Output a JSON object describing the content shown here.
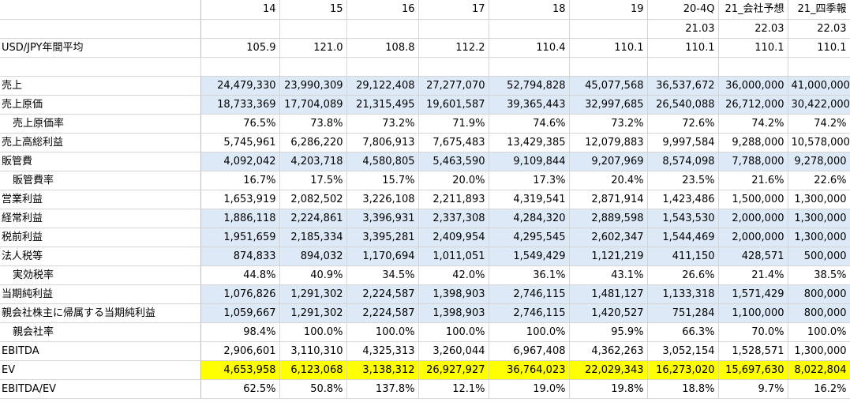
{
  "headers": {
    "years": [
      "14",
      "15",
      "16",
      "17",
      "18",
      "19",
      "20-4Q",
      "21_会社予想",
      "21_四季報"
    ],
    "periods": [
      "",
      "",
      "",
      "",
      "",
      "",
      "21.03",
      "22.03",
      "22.03"
    ]
  },
  "fx": {
    "label": "USD/JPY年間平均",
    "values": [
      "105.9",
      "121.0",
      "108.8",
      "112.2",
      "110.4",
      "110.1",
      "110.1",
      "110.1",
      "110.1"
    ]
  },
  "rows": [
    {
      "label": "売上",
      "style": "blue",
      "indent": false,
      "values": [
        "24,479,330",
        "23,990,309",
        "29,122,408",
        "27,277,070",
        "52,794,828",
        "45,077,568",
        "36,537,672",
        "36,000,000",
        "41,000,000"
      ]
    },
    {
      "label": "売上原価",
      "style": "blue",
      "indent": false,
      "values": [
        "18,733,369",
        "17,704,089",
        "21,315,495",
        "19,601,587",
        "39,365,443",
        "32,997,685",
        "26,540,088",
        "26,712,000",
        "30,422,000"
      ]
    },
    {
      "label": "売上原価率",
      "style": "plain",
      "indent": true,
      "values": [
        "76.5%",
        "73.8%",
        "73.2%",
        "71.9%",
        "74.6%",
        "73.2%",
        "72.6%",
        "74.2%",
        "74.2%"
      ]
    },
    {
      "label": "売上高総利益",
      "style": "plain",
      "indent": false,
      "values": [
        "5,745,961",
        "6,286,220",
        "7,806,913",
        "7,675,483",
        "13,429,385",
        "12,079,883",
        "9,997,584",
        "9,288,000",
        "10,578,000"
      ]
    },
    {
      "label": "販管費",
      "style": "blue",
      "indent": false,
      "values": [
        "4,092,042",
        "4,203,718",
        "4,580,805",
        "5,463,590",
        "9,109,844",
        "9,207,969",
        "8,574,098",
        "7,788,000",
        "9,278,000"
      ]
    },
    {
      "label": "販管費率",
      "style": "plain",
      "indent": true,
      "values": [
        "16.7%",
        "17.5%",
        "15.7%",
        "20.0%",
        "17.3%",
        "20.4%",
        "23.5%",
        "21.6%",
        "22.6%"
      ]
    },
    {
      "label": "営業利益",
      "style": "plain",
      "indent": false,
      "values": [
        "1,653,919",
        "2,082,502",
        "3,226,108",
        "2,211,893",
        "4,319,541",
        "2,871,914",
        "1,423,486",
        "1,500,000",
        "1,300,000"
      ]
    },
    {
      "label": "経常利益",
      "style": "blue",
      "indent": false,
      "values": [
        "1,886,118",
        "2,224,861",
        "3,396,931",
        "2,337,308",
        "4,284,320",
        "2,889,598",
        "1,543,530",
        "2,000,000",
        "1,300,000"
      ]
    },
    {
      "label": "税前利益",
      "style": "blue",
      "indent": false,
      "values": [
        "1,951,659",
        "2,185,334",
        "3,395,281",
        "2,409,954",
        "4,295,545",
        "2,602,347",
        "1,544,469",
        "2,000,000",
        "1,300,000"
      ]
    },
    {
      "label": "法人税等",
      "style": "blue",
      "indent": false,
      "values": [
        "874,833",
        "894,032",
        "1,170,694",
        "1,011,051",
        "1,549,429",
        "1,121,219",
        "411,150",
        "428,571",
        "500,000"
      ]
    },
    {
      "label": "実効税率",
      "style": "plain",
      "indent": true,
      "values": [
        "44.8%",
        "40.9%",
        "34.5%",
        "42.0%",
        "36.1%",
        "43.1%",
        "26.6%",
        "21.4%",
        "38.5%"
      ]
    },
    {
      "label": "当期純利益",
      "style": "blue",
      "indent": false,
      "values": [
        "1,076,826",
        "1,291,302",
        "2,224,587",
        "1,398,903",
        "2,746,115",
        "1,481,127",
        "1,133,318",
        "1,571,429",
        "800,000"
      ]
    },
    {
      "label": "親会社株主に帰属する当期純利益",
      "style": "blue",
      "indent": false,
      "values": [
        "1,059,667",
        "1,291,302",
        "2,224,587",
        "1,398,903",
        "2,746,115",
        "1,420,527",
        "751,284",
        "1,100,000",
        "800,000"
      ]
    },
    {
      "label": "親会社率",
      "style": "plain",
      "indent": true,
      "values": [
        "98.4%",
        "100.0%",
        "100.0%",
        "100.0%",
        "100.0%",
        "95.9%",
        "66.3%",
        "70.0%",
        "100.0%"
      ]
    },
    {
      "label": "EBITDA",
      "style": "plain",
      "indent": false,
      "values": [
        "2,906,601",
        "3,110,310",
        "4,325,313",
        "3,260,044",
        "6,967,408",
        "4,362,263",
        "3,052,154",
        "1,528,571",
        "1,300,000"
      ]
    },
    {
      "label": "EV",
      "style": "yellow",
      "indent": false,
      "values": [
        "4,653,958",
        "6,123,068",
        "3,138,312",
        "26,927,927",
        "36,764,023",
        "22,029,343",
        "16,273,020",
        "15,697,630",
        "8,022,804"
      ]
    },
    {
      "label": "EBITDA/EV",
      "style": "plain",
      "indent": false,
      "values": [
        "62.5%",
        "50.8%",
        "137.8%",
        "12.1%",
        "19.0%",
        "19.8%",
        "18.8%",
        "9.7%",
        "16.2%"
      ]
    }
  ]
}
